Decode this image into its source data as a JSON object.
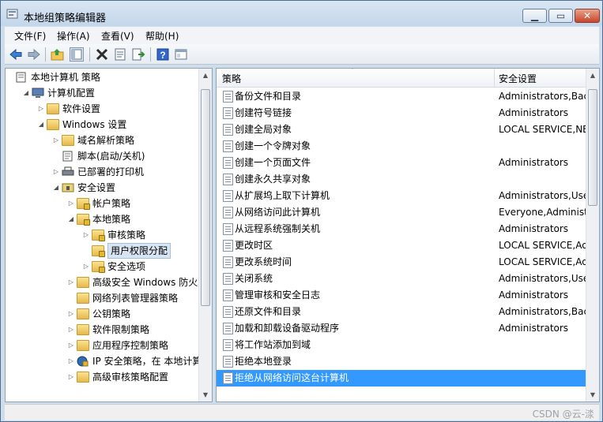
{
  "window": {
    "title": "本地组策略编辑器"
  },
  "menubar": {
    "items": [
      "文件(F)",
      "操作(A)",
      "查看(V)",
      "帮助(H)"
    ]
  },
  "tree": [
    {
      "label": "本地计算机 策略",
      "level": 0,
      "icon": "policy-doc-icon",
      "arrow": ""
    },
    {
      "label": "计算机配置",
      "level": 1,
      "icon": "computer-icon",
      "arrow": "expanded"
    },
    {
      "label": "软件设置",
      "level": 2,
      "icon": "folder-icon",
      "arrow": "collapsed"
    },
    {
      "label": "Windows 设置",
      "level": 2,
      "icon": "folder-icon",
      "arrow": "expanded"
    },
    {
      "label": "域名解析策略",
      "level": 3,
      "icon": "folder-icon",
      "arrow": "collapsed"
    },
    {
      "label": "脚本(启动/关机)",
      "level": 3,
      "icon": "script-icon",
      "arrow": ""
    },
    {
      "label": "已部署的打印机",
      "level": 3,
      "icon": "printer-icon",
      "arrow": "collapsed"
    },
    {
      "label": "安全设置",
      "level": 3,
      "icon": "security-icon",
      "arrow": "expanded"
    },
    {
      "label": "帐户策略",
      "level": 4,
      "icon": "folder-lock-icon",
      "arrow": "collapsed"
    },
    {
      "label": "本地策略",
      "level": 4,
      "icon": "folder-lock-icon",
      "arrow": "expanded"
    },
    {
      "label": "审核策略",
      "level": 5,
      "icon": "folder-lock-icon",
      "arrow": "collapsed"
    },
    {
      "label": "用户权限分配",
      "level": 5,
      "icon": "folder-lock-icon",
      "arrow": "",
      "selected": true
    },
    {
      "label": "安全选项",
      "level": 5,
      "icon": "folder-lock-icon",
      "arrow": "collapsed"
    },
    {
      "label": "高级安全 Windows 防火墙",
      "level": 4,
      "icon": "folder-icon",
      "arrow": "collapsed"
    },
    {
      "label": "网络列表管理器策略",
      "level": 4,
      "icon": "folder-icon",
      "arrow": ""
    },
    {
      "label": "公钥策略",
      "level": 4,
      "icon": "folder-icon",
      "arrow": "collapsed"
    },
    {
      "label": "软件限制策略",
      "level": 4,
      "icon": "folder-icon",
      "arrow": "collapsed"
    },
    {
      "label": "应用程序控制策略",
      "level": 4,
      "icon": "folder-icon",
      "arrow": "collapsed"
    },
    {
      "label": "IP 安全策略，在 本地计算机",
      "level": 4,
      "icon": "ipsec-icon",
      "arrow": "collapsed"
    },
    {
      "label": "高级审核策略配置",
      "level": 4,
      "icon": "folder-icon",
      "arrow": "collapsed"
    }
  ],
  "list": {
    "columns": [
      "策略",
      "安全设置"
    ],
    "rows": [
      {
        "policy": "备份文件和目录",
        "setting": "Administrators,Backup"
      },
      {
        "policy": "创建符号链接",
        "setting": "Administrators"
      },
      {
        "policy": "创建全局对象",
        "setting": "LOCAL SERVICE,NE"
      },
      {
        "policy": "创建一个令牌对象",
        "setting": ""
      },
      {
        "policy": "创建一个页面文件",
        "setting": "Administrators"
      },
      {
        "policy": "创建永久共享对象",
        "setting": ""
      },
      {
        "policy": "从扩展坞上取下计算机",
        "setting": "Administrators,Use"
      },
      {
        "policy": "从网络访问此计算机",
        "setting": "Everyone,Administr"
      },
      {
        "policy": "从远程系统强制关机",
        "setting": "Administrators"
      },
      {
        "policy": "更改时区",
        "setting": "LOCAL SERVICE,Ad"
      },
      {
        "policy": "更改系统时间",
        "setting": "LOCAL SERVICE,Ad"
      },
      {
        "policy": "关闭系统",
        "setting": "Administrators,Use"
      },
      {
        "policy": "管理审核和安全日志",
        "setting": "Administrators"
      },
      {
        "policy": "还原文件和目录",
        "setting": "Administrators,Backup"
      },
      {
        "policy": "加载和卸载设备驱动程序",
        "setting": "Administrators"
      },
      {
        "policy": "将工作站添加到域",
        "setting": ""
      },
      {
        "policy": "拒绝本地登录",
        "setting": ""
      },
      {
        "policy": "拒绝从网络访问这台计算机",
        "setting": "",
        "selected": true
      }
    ]
  },
  "watermark": "CSDN @云-渁",
  "colors": {
    "selection": "#3399ff",
    "titlebar": "#c3d6ea",
    "close": "#c8452c"
  }
}
